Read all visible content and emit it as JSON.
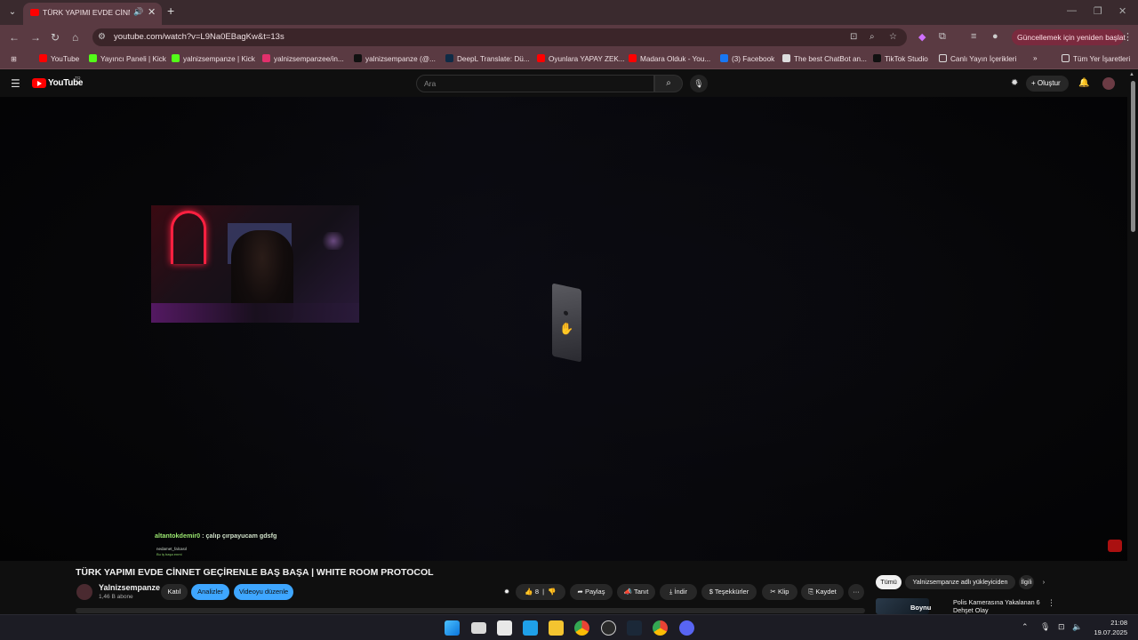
{
  "browser": {
    "tab_title": "TÜRK YAPIMI EVDE CİNNET",
    "url": "youtube.com/watch?v=L9Na0EBagKw&t=13s",
    "update_label": "Güncellemek için yeniden başlat"
  },
  "bookmarks": {
    "items": [
      {
        "label": "YouTube",
        "color": "#ff0000"
      },
      {
        "label": "Yayıncı Paneli | Kick",
        "color": "#53fc18"
      },
      {
        "label": "yalnizsempanze | Kick",
        "color": "#53fc18"
      },
      {
        "label": "yalnizsempanzee/in...",
        "color": "#e1306c"
      },
      {
        "label": "yalnizsempanze (@...",
        "color": "#111111"
      },
      {
        "label": "DeepL Translate: Dü...",
        "color": "#0f2b46"
      },
      {
        "label": "Oyunlara YAPAY ZEK...",
        "color": "#ff0000"
      },
      {
        "label": "Madara Olduk - You...",
        "color": "#ff0000"
      },
      {
        "label": "(3) Facebook",
        "color": "#1877f2"
      },
      {
        "label": "The best ChatBot an...",
        "color": "#dddddd"
      },
      {
        "label": "TikTok Studio",
        "color": "#111111"
      },
      {
        "label": "Canlı Yayın İçerikleri",
        "color": "#5a3a42"
      }
    ],
    "more": "»",
    "all_label": "Tüm Yer İşaretleri"
  },
  "youtube": {
    "wordmark": "YouTube",
    "region": "TR",
    "search_placeholder": "Ara",
    "create_label": "Oluştur"
  },
  "player": {
    "chat_user": "altantokdemir0",
    "chat_message": " : çalıp çırpayucam gdsfg",
    "chat_small_user": "nedamet_falcasıl",
    "chat_small_msg": "Bu iş başa enmi"
  },
  "video": {
    "title": "TÜRK YAPIMI EVDE CİNNET GEÇİRENLE BAŞ BAŞA | WHITE ROOM PROTOCOL",
    "channel": "Yalnizsempanze",
    "subs": "1,46 B abone",
    "join": "Katıl",
    "analytics": "Analizler",
    "edit": "Videoyu düzenle",
    "likes": "8",
    "share": "Paylaş",
    "promote": "Tanıt",
    "download": "İndir",
    "thanks": "Teşekkürler",
    "clip": "Klip",
    "save": "Kaydet",
    "more": "···"
  },
  "recommendations": {
    "chips": [
      "Tümü",
      "Yalnizsempanze adlı yükleyiciden",
      "İlgili"
    ],
    "first_title": "Polis Kamerasına Yakalanan 6 Dehşet Olay",
    "first_label": "Boynu"
  },
  "taskbar": {
    "time": "21:08",
    "date": "19.07.2025"
  }
}
